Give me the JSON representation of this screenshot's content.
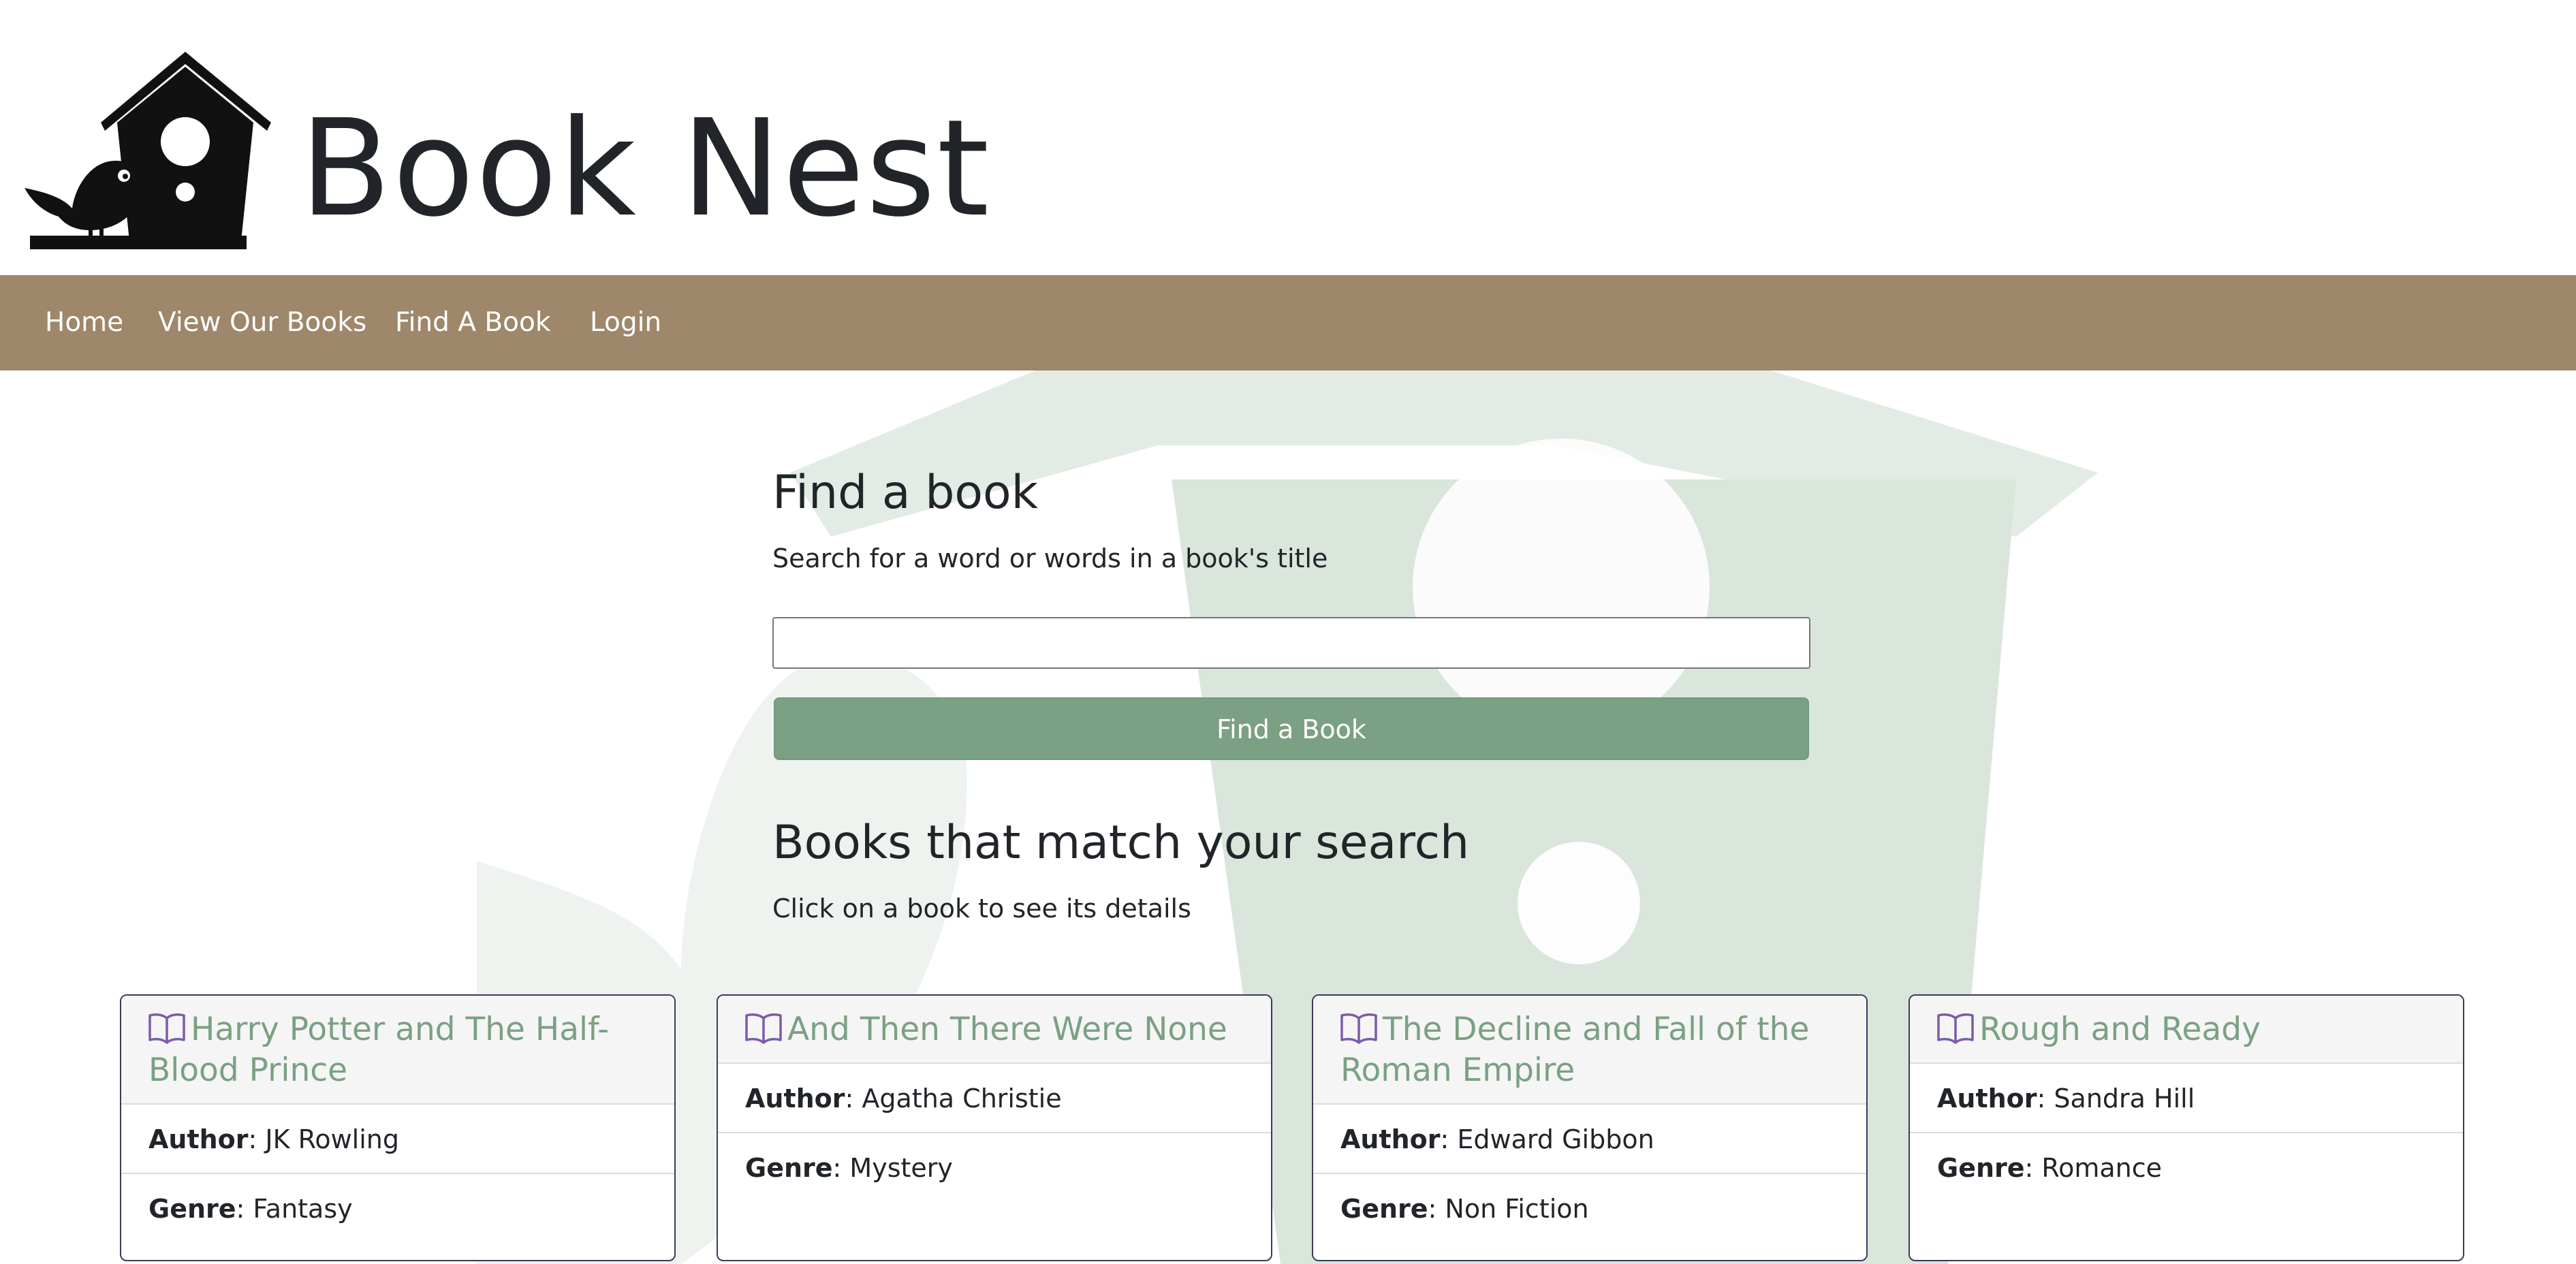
{
  "site": {
    "title": "Book Nest",
    "logo_icon": "birdhouse-bird-logo"
  },
  "nav": {
    "items": [
      {
        "label": "Home"
      },
      {
        "label": "View Our Books"
      },
      {
        "label": "Find A Book"
      },
      {
        "label": "Login"
      }
    ]
  },
  "search": {
    "heading": "Find a book",
    "description": "Search for a word or words in a book's title",
    "input_value": "",
    "button_label": "Find a Book"
  },
  "results": {
    "heading": "Books that match your search",
    "description": "Click on a book to see its details",
    "author_label": "Author",
    "genre_label": "Genre",
    "books": [
      {
        "title": "Harry Potter and The Half-Blood Prince",
        "author": "JK Rowling",
        "genre": "Fantasy"
      },
      {
        "title": "And Then There Were None",
        "author": "Agatha Christie",
        "genre": "Mystery"
      },
      {
        "title": "The Decline and Fall of the Roman Empire",
        "author": "Edward Gibbon",
        "genre": "Non Fiction"
      },
      {
        "title": "Rough and Ready",
        "author": "Sandra Hill",
        "genre": "Romance"
      }
    ]
  },
  "colors": {
    "navbar": "#9e876a",
    "accent_green": "#7ba083",
    "card_border": "#3d3a5c",
    "book_icon": "#7a5ca8"
  }
}
